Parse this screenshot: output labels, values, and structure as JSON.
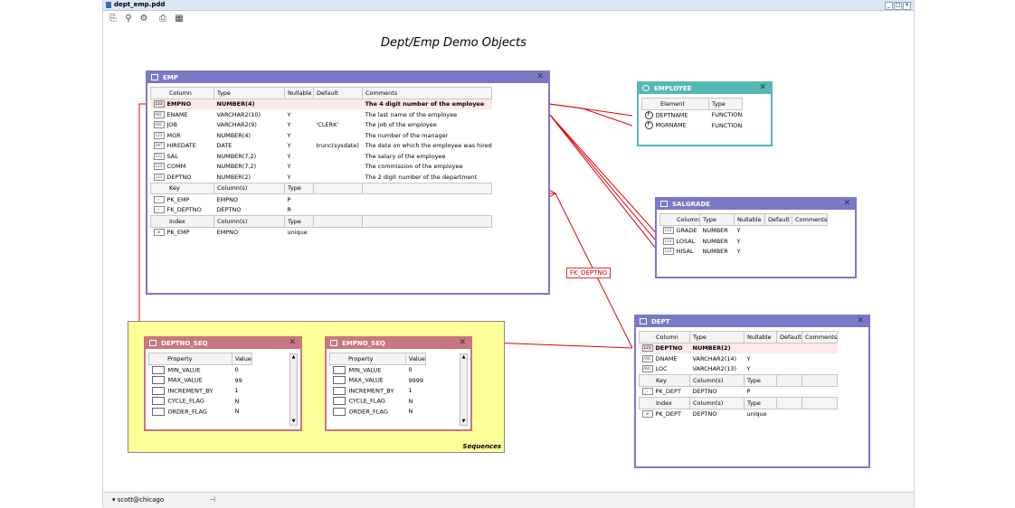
{
  "window": {
    "title": "dept_emp.pdd",
    "buttons": [
      "_",
      "□",
      "×"
    ]
  },
  "toolbar": {
    "icons": [
      "new-diagram-icon",
      "zoom-icon",
      "settings-icon",
      "print-icon",
      "grid-icon"
    ]
  },
  "diagram": {
    "title": "Dept/Emp Demo Objects"
  },
  "emp": {
    "title": "EMP",
    "columns_header": [
      "Column",
      "Type",
      "Nullable",
      "Default",
      "Comments"
    ],
    "columns": [
      {
        "icon": "123",
        "name": "EMPNO",
        "type": "NUMBER(4)",
        "nullable": "",
        "default": "",
        "comment": "The 4 digit number of the employee",
        "pk": true
      },
      {
        "icon": "ABC",
        "name": "ENAME",
        "type": "VARCHAR2(10)",
        "nullable": "Y",
        "default": "",
        "comment": "The last name of the employee"
      },
      {
        "icon": "ABC",
        "name": "JOB",
        "type": "VARCHAR2(9)",
        "nullable": "Y",
        "default": "'CLERK'",
        "comment": "The job of the employee"
      },
      {
        "icon": "123",
        "name": "MGR",
        "type": "NUMBER(4)",
        "nullable": "Y",
        "default": "",
        "comment": "The number of the manager"
      },
      {
        "icon": "DAT",
        "name": "HIREDATE",
        "type": "DATE",
        "nullable": "Y",
        "default": "trunc(sysdate)",
        "comment": "The date on which the employee was hired"
      },
      {
        "icon": "123",
        "name": "SAL",
        "type": "NUMBER(7,2)",
        "nullable": "Y",
        "default": "",
        "comment": "The salary of the employee"
      },
      {
        "icon": "123",
        "name": "COMM",
        "type": "NUMBER(7,2)",
        "nullable": "Y",
        "default": "",
        "comment": "The commission of the employee"
      },
      {
        "icon": "123",
        "name": "DEPTNO",
        "type": "NUMBER(2)",
        "nullable": "Y",
        "default": "",
        "comment": "The 2 digit number of the department"
      }
    ],
    "keys_header": [
      "Key",
      "Column(s)",
      "Type"
    ],
    "keys": [
      {
        "name": "PK_EMP",
        "columns": "EMPNO",
        "type": "P"
      },
      {
        "name": "FK_DEPTNO",
        "columns": "DEPTNO",
        "type": "R"
      }
    ],
    "index_header": [
      "Index",
      "Column(s)",
      "Type"
    ],
    "indexes": [
      {
        "name": "PK_EMP",
        "columns": "EMPNO",
        "type": "unique"
      }
    ]
  },
  "employee": {
    "title": "EMPLOYEE",
    "header": [
      "Element",
      "Type"
    ],
    "rows": [
      {
        "name": "DEPTNAME",
        "type": "FUNCTION"
      },
      {
        "name": "MGRNAME",
        "type": "FUNCTION"
      }
    ]
  },
  "salgrade": {
    "title": "SALGRADE",
    "header": [
      "Column",
      "Type",
      "Nullable",
      "Default",
      "Comments"
    ],
    "rows": [
      {
        "name": "GRADE",
        "type": "NUMBER",
        "nullable": "Y"
      },
      {
        "name": "LOSAL",
        "type": "NUMBER",
        "nullable": "Y"
      },
      {
        "name": "HISAL",
        "type": "NUMBER",
        "nullable": "Y"
      }
    ]
  },
  "dept": {
    "title": "DEPT",
    "columns_header": [
      "Column",
      "Type",
      "Nullable",
      "Default",
      "Comments"
    ],
    "columns": [
      {
        "icon": "123",
        "name": "DEPTNO",
        "type": "NUMBER(2)",
        "nullable": "",
        "pk": true
      },
      {
        "icon": "ABC",
        "name": "DNAME",
        "type": "VARCHAR2(14)",
        "nullable": "Y"
      },
      {
        "icon": "ABC",
        "name": "LOC",
        "type": "VARCHAR2(13)",
        "nullable": "Y"
      }
    ],
    "keys_header": [
      "Key",
      "Column(s)",
      "Type"
    ],
    "keys": [
      {
        "name": "PK_DEPT",
        "columns": "DEPTNO",
        "type": "P"
      }
    ],
    "index_header": [
      "Index",
      "Column(s)",
      "Type"
    ],
    "indexes": [
      {
        "name": "PK_DEPT",
        "columns": "DEPTNO",
        "type": "unique"
      }
    ]
  },
  "deptno_seq": {
    "title": "DEPTNO_SEQ",
    "header": [
      "Property",
      "Value"
    ],
    "rows": [
      {
        "name": "MIN_VALUE",
        "value": "0"
      },
      {
        "name": "MAX_VALUE",
        "value": "99"
      },
      {
        "name": "INCREMENT_BY",
        "value": "1"
      },
      {
        "name": "CYCLE_FLAG",
        "value": "N"
      },
      {
        "name": "ORDER_FLAG",
        "value": "N"
      }
    ]
  },
  "empno_seq": {
    "title": "EMPNO_SEQ",
    "header": [
      "Property",
      "Value"
    ],
    "rows": [
      {
        "name": "MIN_VALUE",
        "value": "0"
      },
      {
        "name": "MAX_VALUE",
        "value": "9999"
      },
      {
        "name": "INCREMENT_BY",
        "value": "1"
      },
      {
        "name": "CYCLE_FLAG",
        "value": "N"
      },
      {
        "name": "ORDER_FLAG",
        "value": "N"
      }
    ]
  },
  "sequences_group": {
    "label": "Sequences"
  },
  "fk_label": "FK_DEPTNO",
  "status": {
    "connection": "scott@chicago",
    "pin_icon": "pin-icon"
  },
  "colors": {
    "table_header": "#7b78c6",
    "type_header": "#55b8b4",
    "sequence_header": "#c9767f",
    "sequence_group": "#ffff99",
    "relation_line": "#e00000",
    "pk_row": "#fde9e9"
  }
}
